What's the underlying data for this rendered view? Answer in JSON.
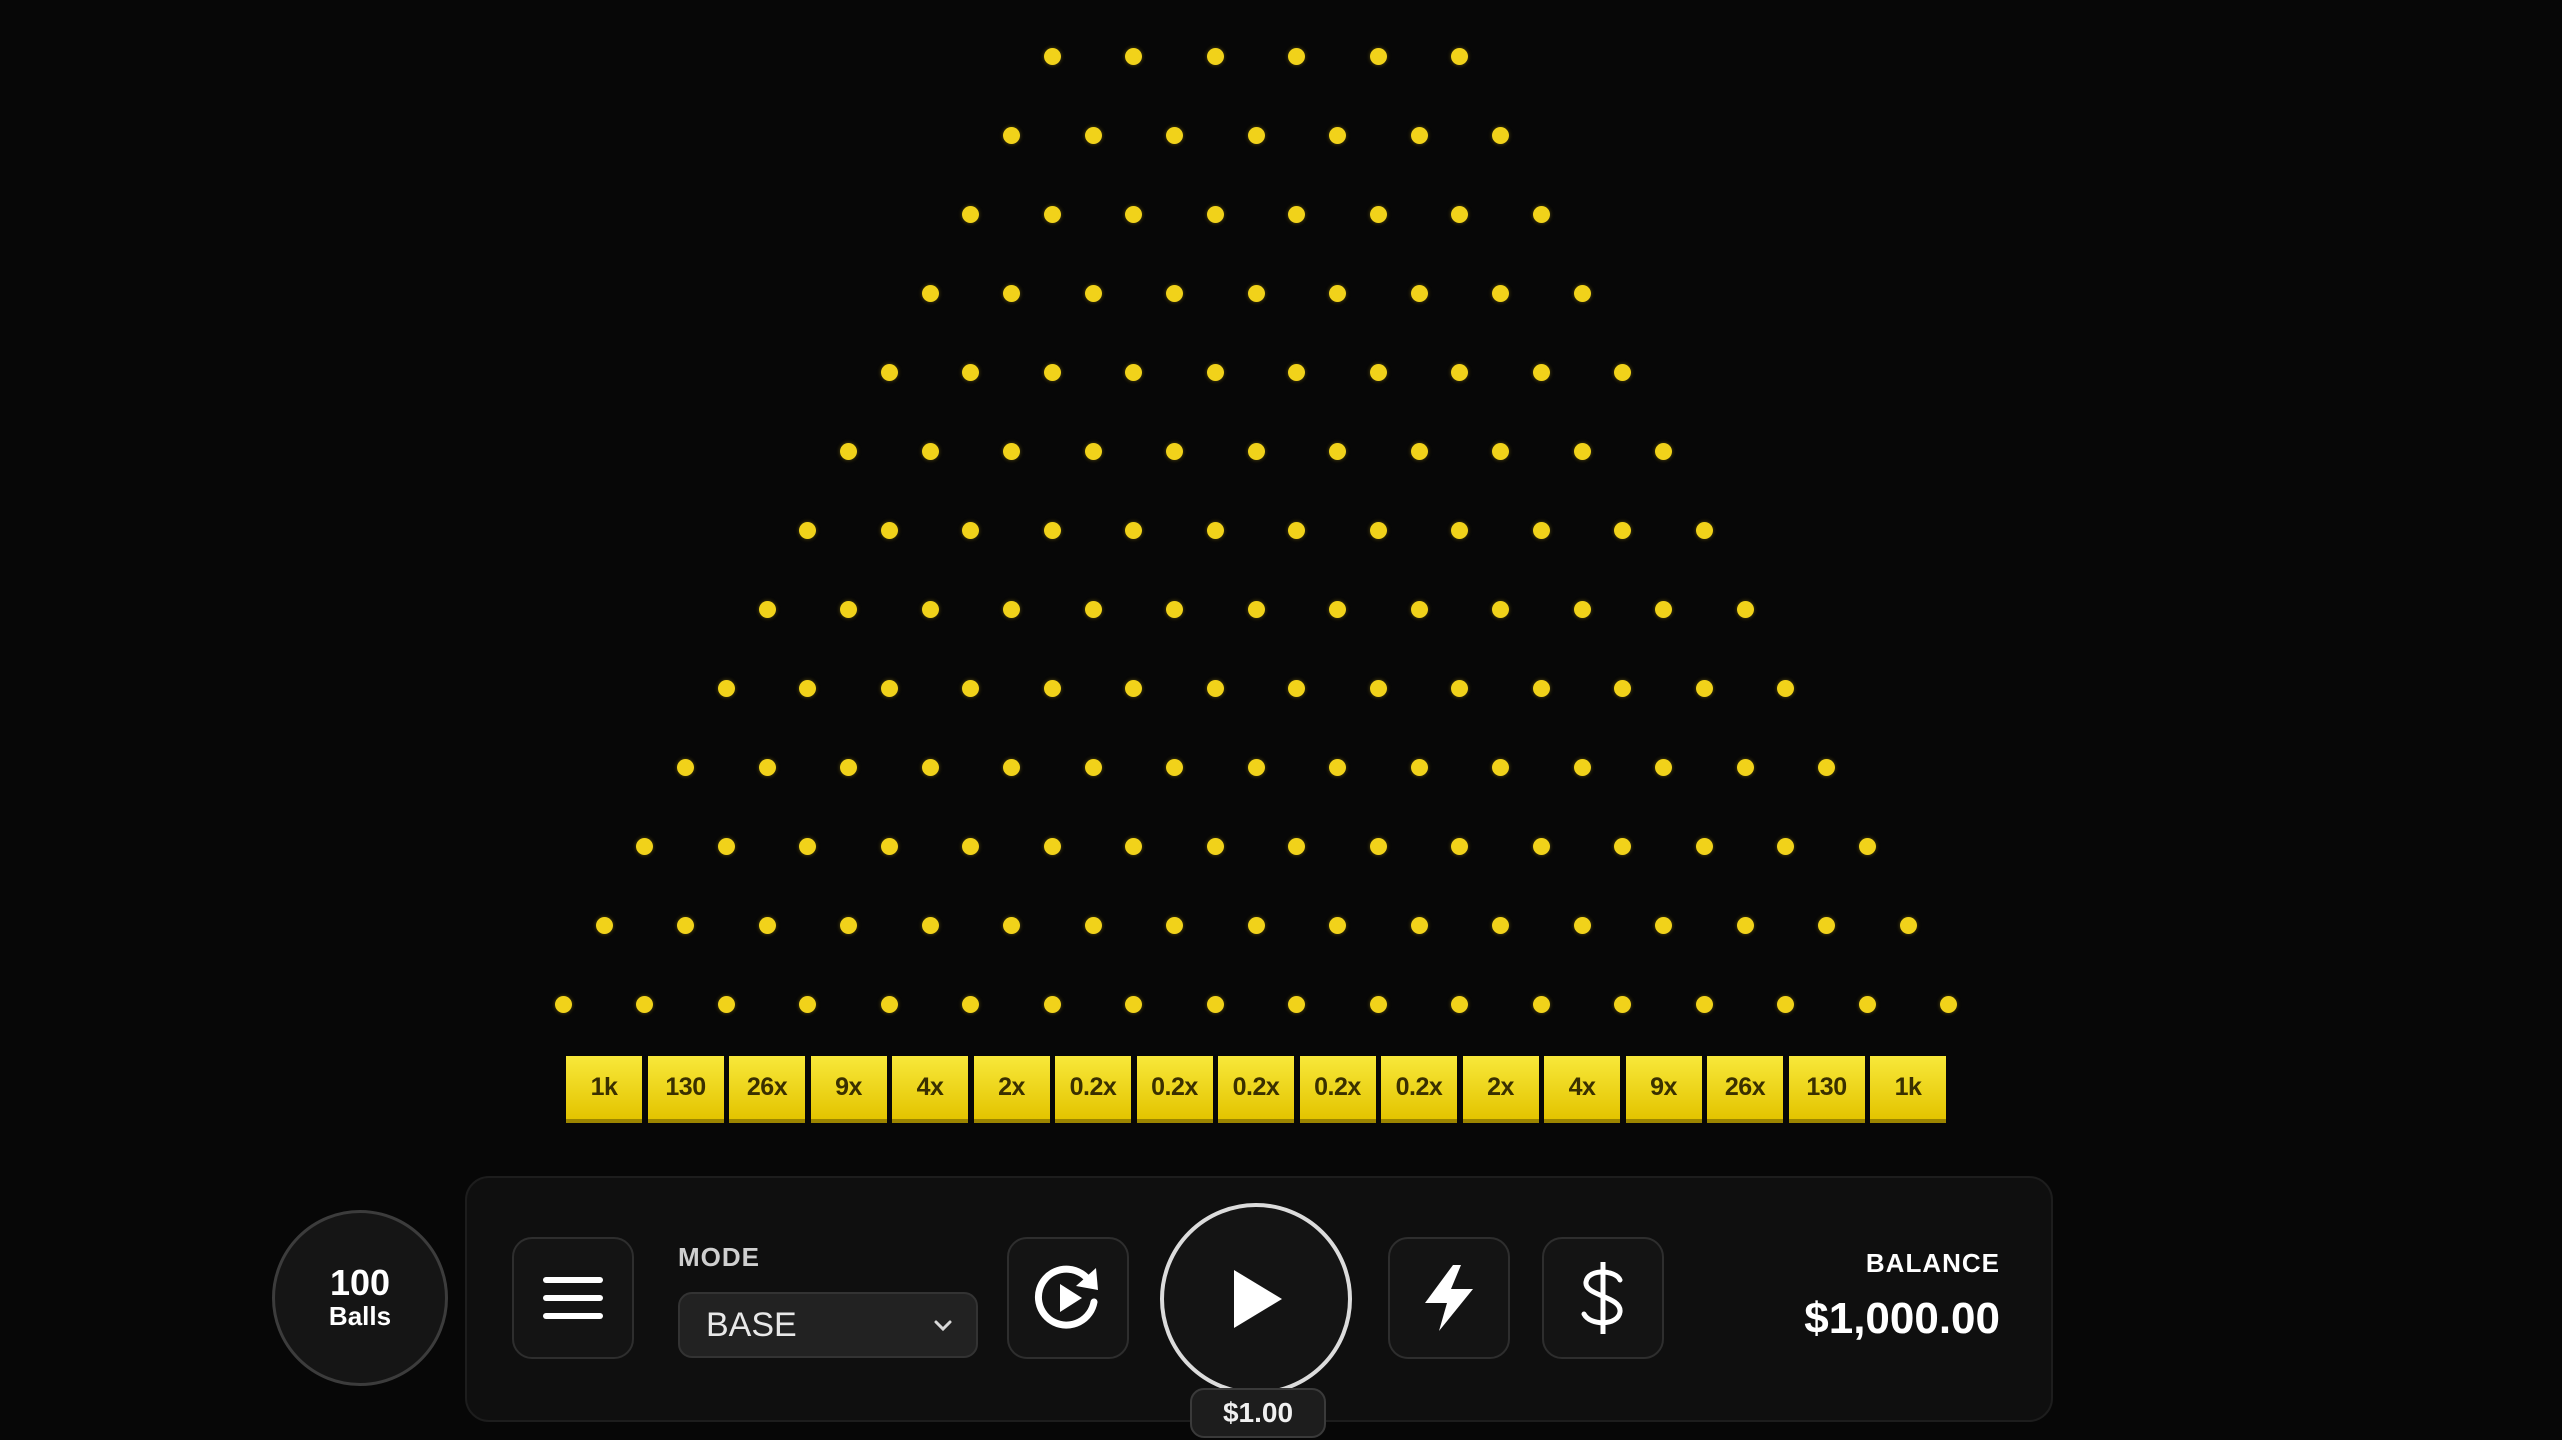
{
  "board": {
    "peg_color": "#f1d21a",
    "rows": 13,
    "first_row_pegs": 6,
    "multipliers": [
      "1k",
      "130",
      "26x",
      "9x",
      "4x",
      "2x",
      "0.2x",
      "0.2x",
      "0.2x",
      "0.2x",
      "0.2x",
      "2x",
      "4x",
      "9x",
      "26x",
      "130",
      "1k"
    ]
  },
  "balls": {
    "count": "100",
    "label": "Balls"
  },
  "controls": {
    "menu_icon": "hamburger-menu-icon",
    "mode_label": "MODE",
    "mode_value": "BASE",
    "autoplay_icon": "autoplay-icon",
    "play_icon": "play-icon",
    "turbo_icon": "lightning-icon",
    "bet_icon": "dollar-icon",
    "bet_amount": "$1.00"
  },
  "balance": {
    "label": "BALANCE",
    "value": "$1,000.00"
  }
}
